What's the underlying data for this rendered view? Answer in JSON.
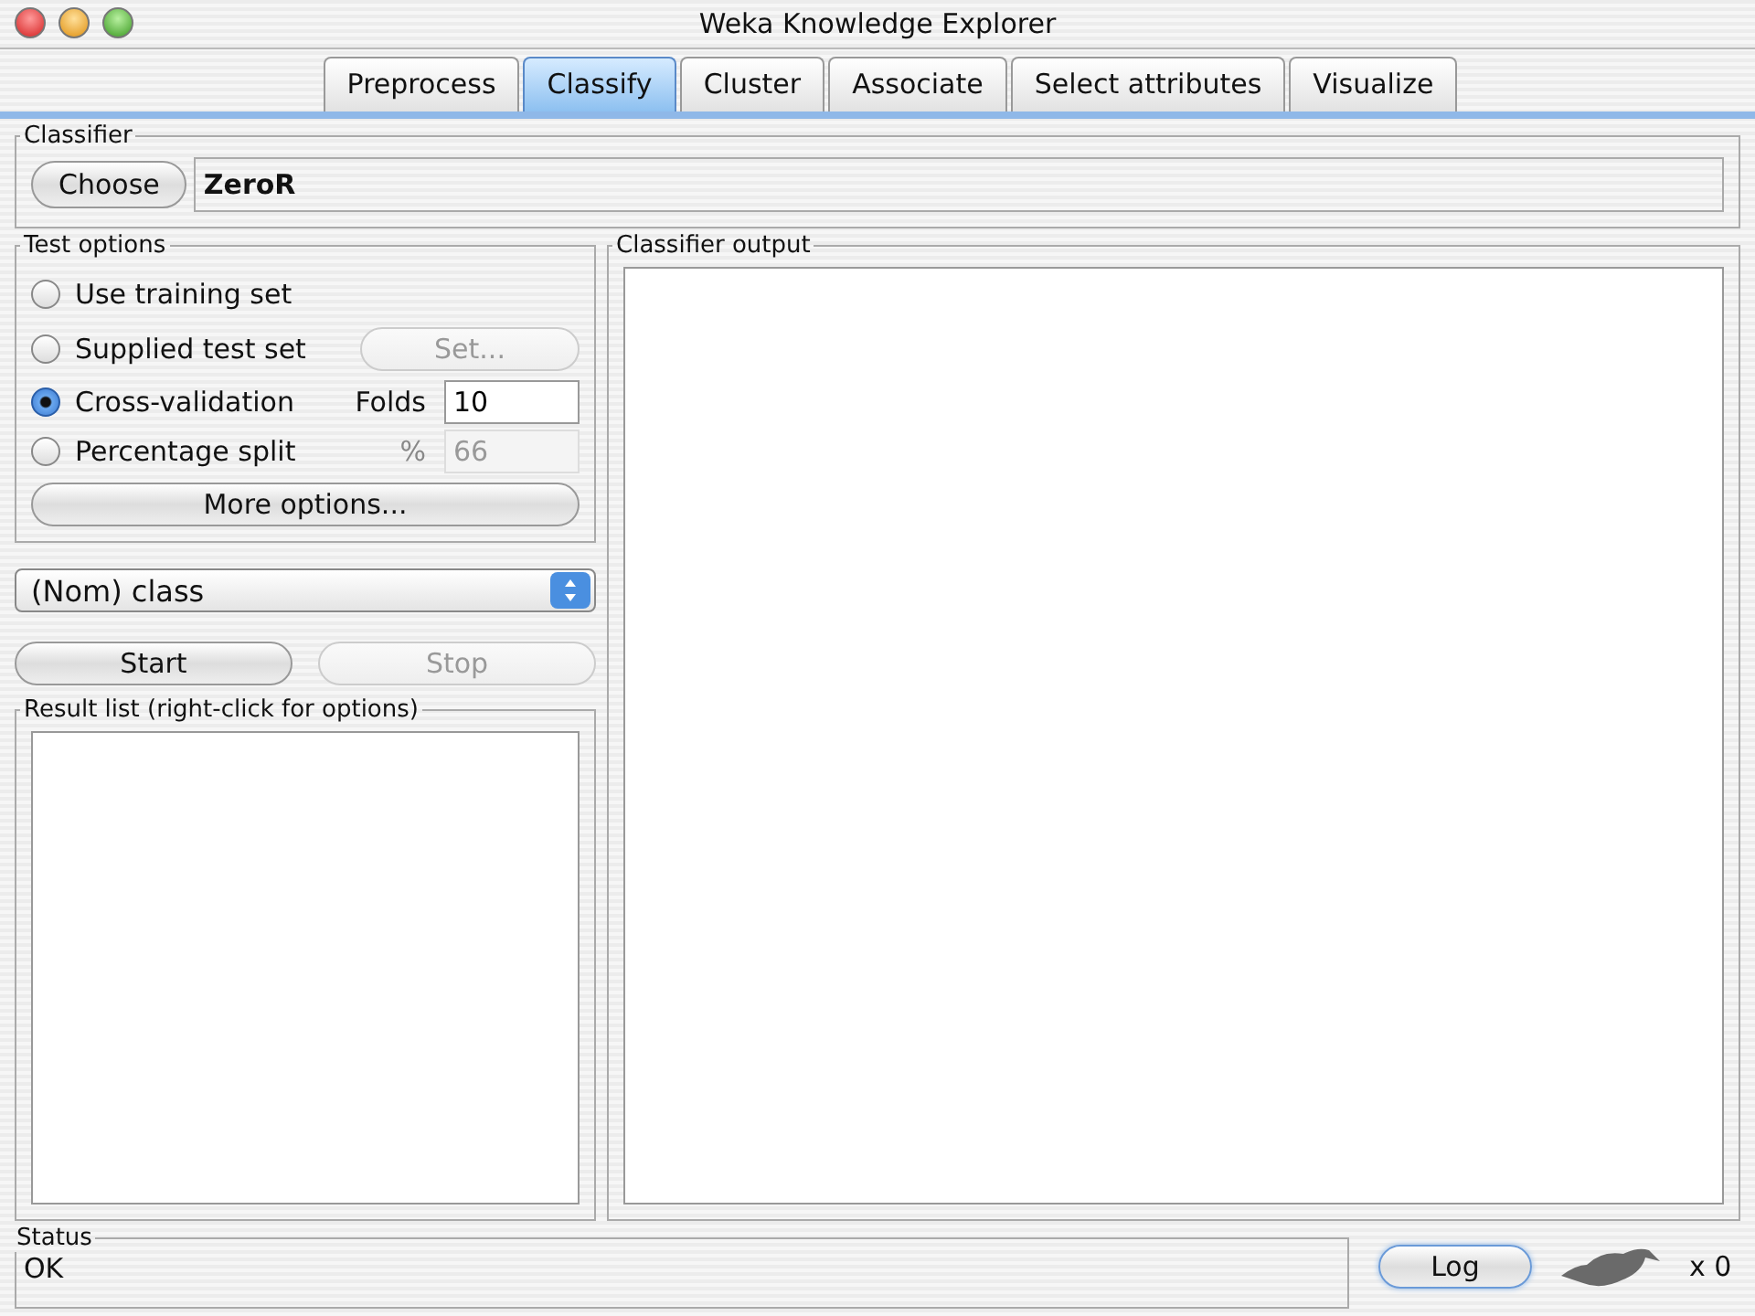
{
  "window": {
    "title": "Weka Knowledge Explorer"
  },
  "tabs": [
    {
      "label": "Preprocess",
      "selected": false
    },
    {
      "label": "Classify",
      "selected": true
    },
    {
      "label": "Cluster",
      "selected": false
    },
    {
      "label": "Associate",
      "selected": false
    },
    {
      "label": "Select attributes",
      "selected": false
    },
    {
      "label": "Visualize",
      "selected": false
    }
  ],
  "classifier": {
    "title": "Classifier",
    "button": "Choose",
    "value": "ZeroR"
  },
  "test_options": {
    "title": "Test options",
    "options": [
      {
        "label": "Use training set",
        "selected": false
      },
      {
        "label": "Supplied test set",
        "selected": false,
        "button": {
          "label": "Set...",
          "disabled": true
        }
      },
      {
        "label": "Cross-validation",
        "selected": true,
        "field": {
          "label": "Folds",
          "value": "10",
          "disabled": false
        }
      },
      {
        "label": "Percentage split",
        "selected": false,
        "field": {
          "label": "%",
          "value": "66",
          "disabled": true
        }
      }
    ],
    "more_button": "More options..."
  },
  "class_select": {
    "value": "(Nom) class"
  },
  "actions": [
    {
      "label": "Start",
      "disabled": false
    },
    {
      "label": "Stop",
      "disabled": true
    }
  ],
  "result_list": {
    "title": "Result list (right-click for options)"
  },
  "output": {
    "title": "Classifier output"
  },
  "status": {
    "title": "Status",
    "text": "OK"
  },
  "log_button": "Log",
  "task_count": "x 0"
}
